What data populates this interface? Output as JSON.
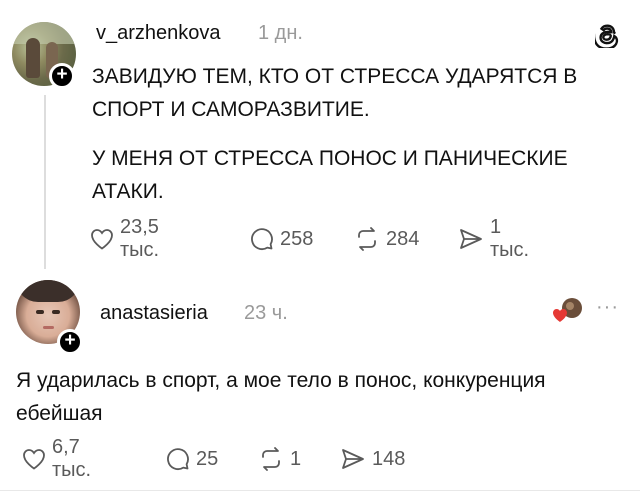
{
  "post": {
    "username": "v_arzhenkova",
    "time": "1 дн.",
    "paragraphs": [
      "ЗАВИДУЮ ТЕМ, КТО ОТ СТРЕССА УДАРЯТСЯ В СПОРТ И САМОРАЗВИТИЕ.",
      "У МЕНЯ ОТ СТРЕССА ПОНОС И ПАНИЧЕСКИЕ АТАКИ."
    ],
    "stats": {
      "likes": "23,5 тыс.",
      "replies": "258",
      "reposts": "284",
      "shares": "1 тыс."
    }
  },
  "reply": {
    "username": "anastasieria",
    "time": "23 ч.",
    "text": "Я ударилась в спорт, а мое тело в понос, конкуренция ебейшая",
    "stats": {
      "likes": "6,7 тыс.",
      "replies": "25",
      "reposts": "1",
      "shares": "148"
    },
    "more": "···"
  },
  "icons": {
    "threads_logo": "threads-logo-icon",
    "like": "heart-icon",
    "reply": "speech-bubble-icon",
    "repost": "repost-arrows-icon",
    "share": "send-icon",
    "follow": "plus-icon"
  }
}
